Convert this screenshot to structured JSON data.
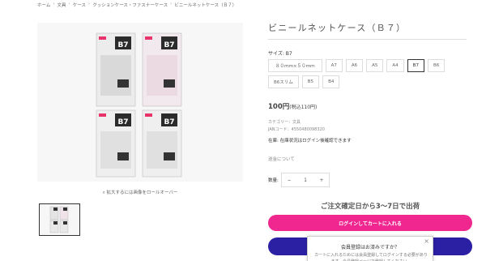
{
  "breadcrumb": [
    "ホーム",
    "文具",
    "ケース",
    "クッションケース・ファスナーケース",
    "ビニールネットケース（Ｂ７）"
  ],
  "product": {
    "title": "ビニールネットケース（Ｂ７）",
    "size_label": "サイズ: B7",
    "size_options": [
      {
        "label": "８０ｍｍ×５０ｍｍ",
        "selected": false
      },
      {
        "label": "A7",
        "selected": false
      },
      {
        "label": "A6",
        "selected": false
      },
      {
        "label": "A5",
        "selected": false
      },
      {
        "label": "A4",
        "selected": false
      },
      {
        "label": "B7",
        "selected": true
      },
      {
        "label": "B6",
        "selected": false
      },
      {
        "label": "B6スリム",
        "selected": false
      },
      {
        "label": "B5",
        "selected": false
      },
      {
        "label": "B4",
        "selected": false
      }
    ],
    "price": "100円",
    "tax": "(税込110円)",
    "category": "カテゴリー：文具",
    "jan": "JANコード：4550480098320",
    "stock": "在庫:  在庫状況はログイン後確認できます",
    "shipping_link": "送金について",
    "qty_label": "数量:",
    "qty_minus": "−",
    "qty_value": "1",
    "qty_plus": "+",
    "ship_date": "ご注文確定日から3〜7日で出荷",
    "login_cart_button": "ログインしてカートに入れる"
  },
  "gallery": {
    "zoom_hint": "⌕  拡大するには画像をロールオーバー"
  },
  "popup": {
    "title": "会員登録はお済みですか？",
    "body": "カートに入れるためには会員登録してログインする必要があります。会員登録ページで登録してください。",
    "close": "×"
  },
  "colors": {
    "pink": "#f0278f",
    "navy": "#2b1fa3"
  }
}
